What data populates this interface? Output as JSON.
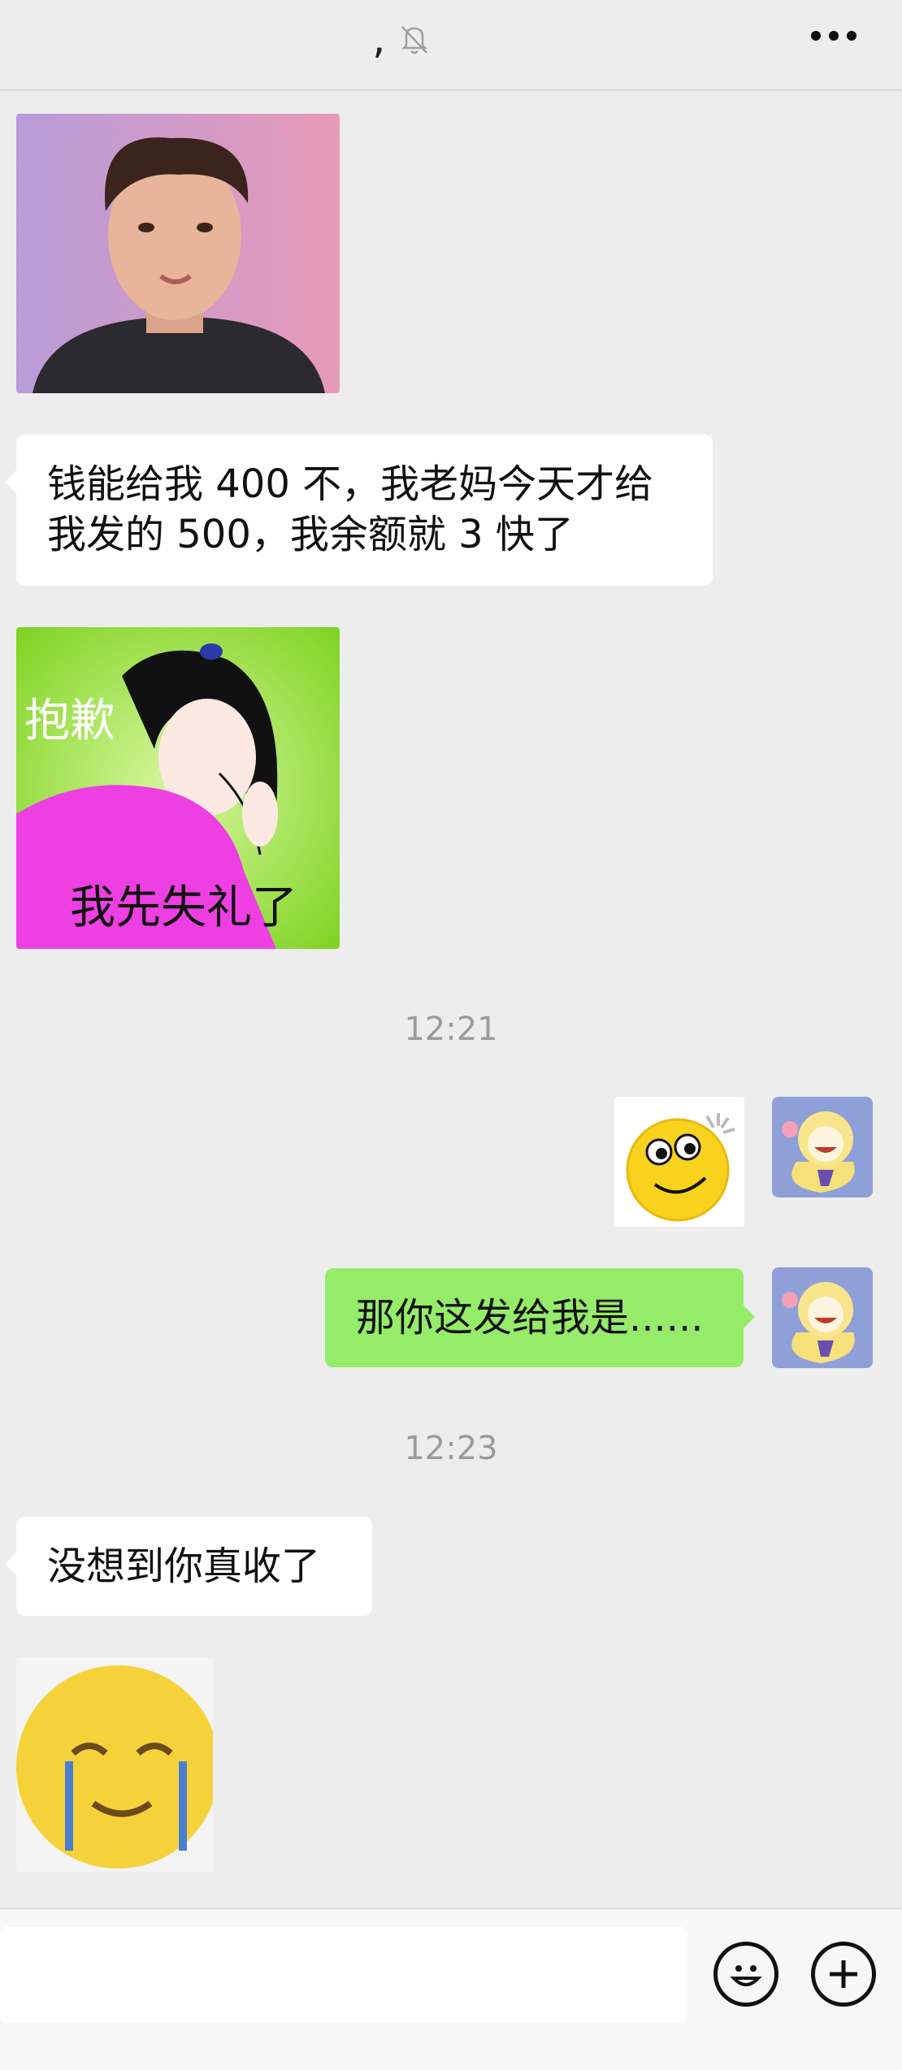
{
  "header": {
    "title": ",",
    "mute_icon": "bell-slash-icon",
    "more_icon": "more-dots-icon"
  },
  "messages": {
    "sticker1": {
      "icon": "man-face-sticker"
    },
    "text1": "钱能给我 400 不，我老妈今天才给\n我发的 500，我余额就 3 快了",
    "sticker2": {
      "caption_top": "抱歉",
      "caption_bottom": "我先失礼了"
    },
    "time1": "12:21",
    "sticker3": {
      "icon": "smiling-emoji-sticker"
    },
    "text2": "那你这发给我是......",
    "time2": "12:23",
    "text3": "没想到你真收了",
    "sticker4": {
      "icon": "crying-smile-emoji-sticker"
    }
  },
  "input_bar": {
    "placeholder": "",
    "emoji_icon": "smiley-icon",
    "plus_icon": "plus-circle-icon"
  },
  "colors": {
    "background": "#ededed",
    "bubble_self": "#95ec69",
    "bubble_other": "#ffffff"
  }
}
